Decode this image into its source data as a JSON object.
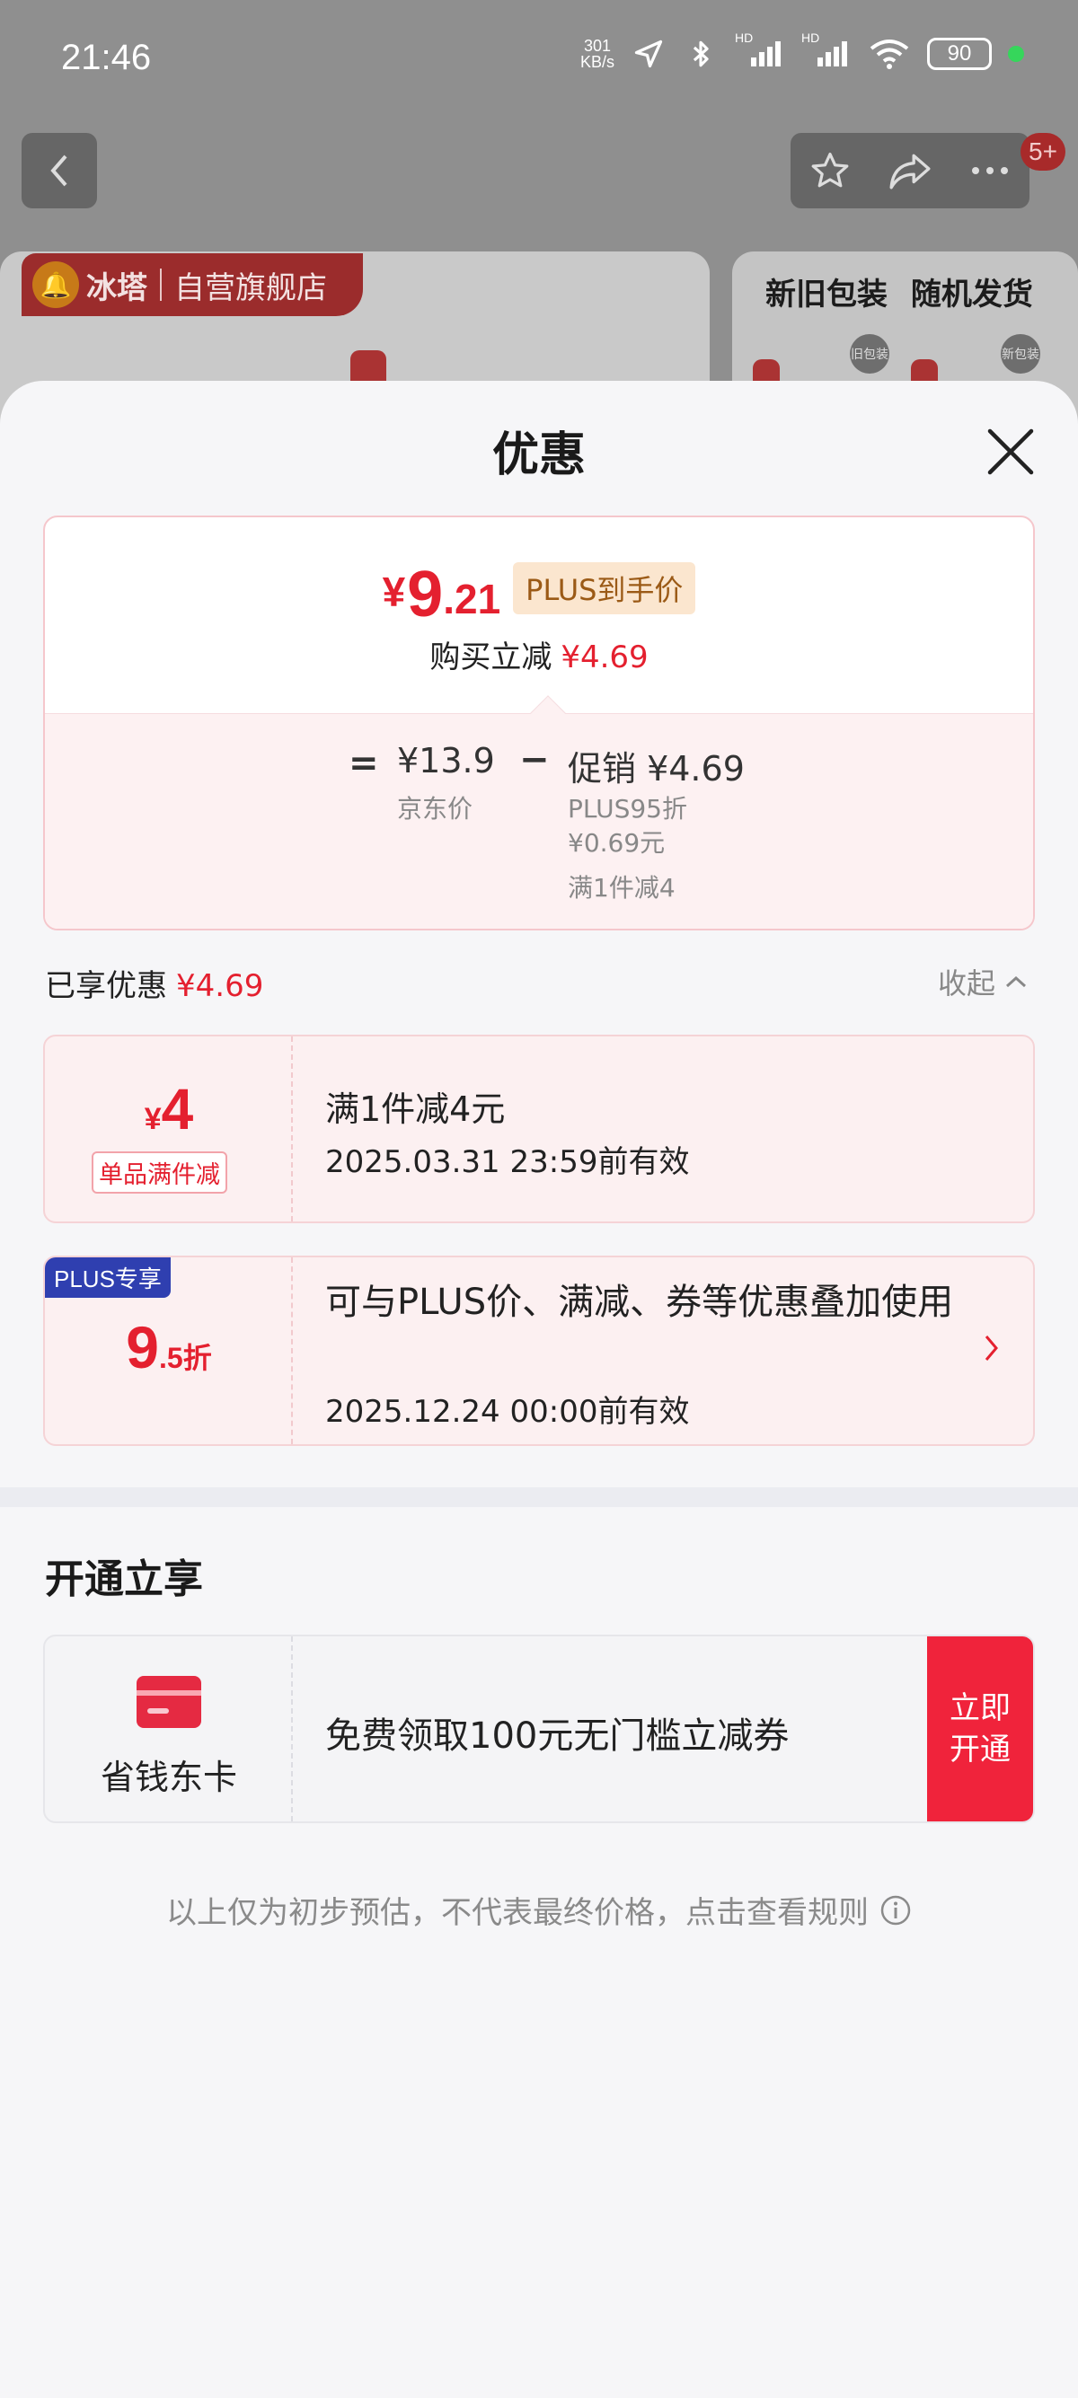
{
  "status_bar": {
    "time": "21:46",
    "net_speed_value": "301",
    "net_speed_unit": "KB/s",
    "hd1": "HD",
    "hd2": "HD",
    "battery": "90"
  },
  "nav": {
    "notification_badge": "5+"
  },
  "backdrop": {
    "store_label": "自营旗舰店",
    "brand": "冰塔",
    "side_label": "新旧包装 随机发货",
    "tag_old": "旧包装",
    "tag_new": "新包装"
  },
  "sheet": {
    "title": "优惠"
  },
  "price_card": {
    "final_yen": "¥",
    "final_int": "9",
    "final_dec": ".21",
    "plus_tag": "PLUS到手价",
    "reduce_label": "购买立减",
    "reduce_value": "¥4.69",
    "eq": "=",
    "jd_price": "¥13.9",
    "jd_label": "京东价",
    "minus": "−",
    "promo_price": "促销 ¥4.69",
    "promo_line1": "PLUS95折",
    "promo_line2": "¥0.69元",
    "promo_line3": "满1件减4"
  },
  "enjoyed": {
    "label": "已享优惠",
    "value": "¥4.69",
    "collapse": "收起"
  },
  "coupon1": {
    "yen": "¥",
    "value": "4",
    "tag": "单品满件减",
    "title": "满1件减4元",
    "date": "2025.03.31 23:59前有效"
  },
  "coupon2": {
    "badge": "PLUS专享",
    "value_int": "9",
    "value_dec": ".5折",
    "title": "可与PLUS价、满减、券等优惠叠加使用",
    "date": "2025.12.24 00:00前有效"
  },
  "open_section": {
    "title": "开通立享",
    "card_name": "省钱东卡",
    "desc": "免费领取100元无门槛立减券",
    "button_line1": "立即",
    "button_line2": "开通"
  },
  "disclaimer": "以上仅为初步预估，不代表最终价格，点击查看规则",
  "colors": {
    "accent_red": "#e4202f",
    "plus_blue": "#2f3fb0",
    "plus_gold_bg": "#fbe6cf"
  }
}
